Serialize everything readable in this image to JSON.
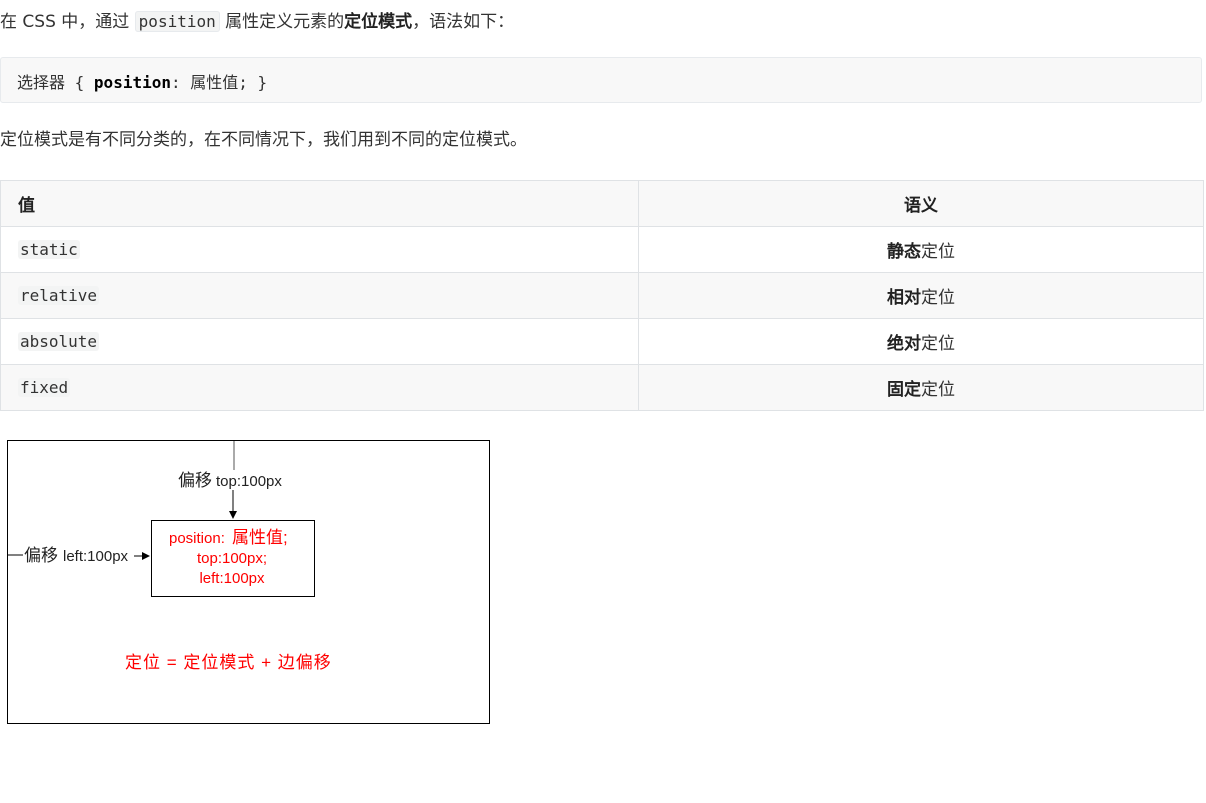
{
  "intro": {
    "prefix": "在 CSS 中，通过 ",
    "code": "position",
    "mid": " 属性定义元素的",
    "bold": "定位模式",
    "suffix": "，语法如下："
  },
  "code_block": {
    "selector": "选择器",
    "open": " { ",
    "property": "position",
    "colon": ": ",
    "value": "属性值",
    "close": "; }"
  },
  "note": "定位模式是有不同分类的，在不同情况下，我们用到不同的定位模式。",
  "table": {
    "headers": [
      "值",
      "语义"
    ],
    "rows": [
      {
        "value": "static",
        "bold": "静态",
        "rest": "定位"
      },
      {
        "value": "relative",
        "bold": "相对",
        "rest": "定位"
      },
      {
        "value": "absolute",
        "bold": "绝对",
        "rest": "定位"
      },
      {
        "value": "fixed",
        "bold": "固定",
        "rest": "定位"
      }
    ]
  },
  "figure": {
    "top_offset_cn": "偏移",
    "top_offset_val": "top:100px",
    "left_offset_cn": "偏移",
    "left_offset_val": "left:100px",
    "box_line1_a": "position:",
    "box_line1_b": "属性值;",
    "box_line2": "top:100px;",
    "box_line3": "left:100px",
    "formula": "定位 = 定位模式 + 边偏移",
    "accent_color": "#ff0000",
    "line_color": "#000000"
  }
}
